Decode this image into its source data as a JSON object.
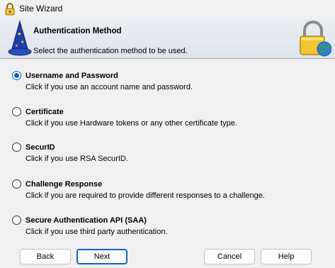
{
  "window": {
    "title": "Site Wizard",
    "app_icon": "lock-icon"
  },
  "header": {
    "title": "Authentication Method",
    "subtitle": "Select the authentication method to be used.",
    "left_icon": "wizard-hat-icon",
    "right_icon": "padlock-globe-icon"
  },
  "options": [
    {
      "label": "Username and Password",
      "description": "Click if you use an account name and password.",
      "selected": true
    },
    {
      "label": "Certificate",
      "description": "Click if you use Hardware tokens or any other certificate type.",
      "selected": false
    },
    {
      "label": "SecurID",
      "description": "Click if you use RSA SecurID.",
      "selected": false
    },
    {
      "label": "Challenge Response",
      "description": "Click if you are required to provide different responses to a challenge.",
      "selected": false
    },
    {
      "label": "Secure Authentication API (SAA)",
      "description": "Click if you use third party authentication.",
      "selected": false
    }
  ],
  "buttons": {
    "back": "Back",
    "next": "Next",
    "cancel": "Cancel",
    "help": "Help"
  },
  "colors": {
    "accent": "#0a64c8",
    "header_bg": "#e3e7ee",
    "window_bg": "#f0f0f0"
  }
}
